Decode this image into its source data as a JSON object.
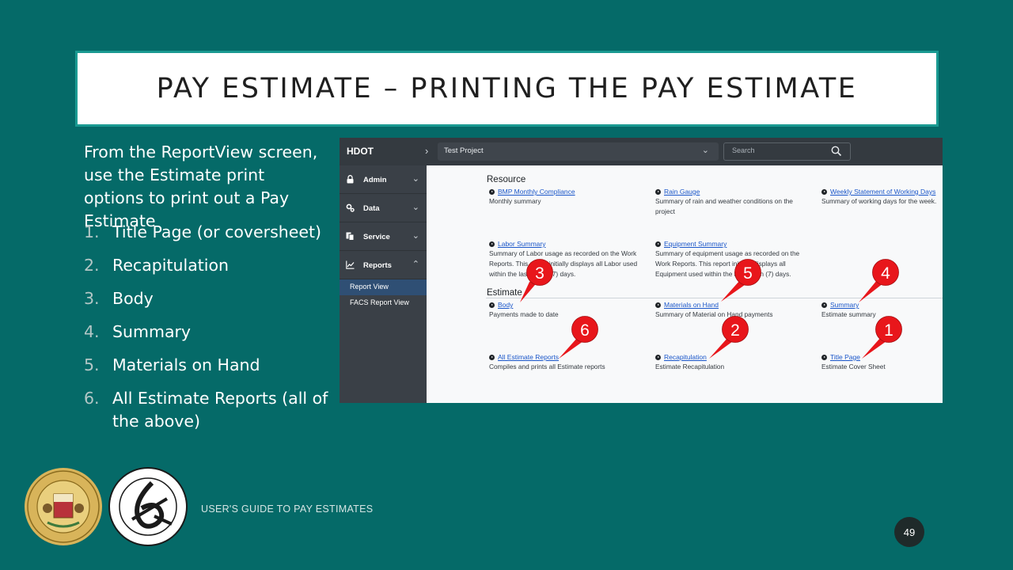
{
  "slide": {
    "title": "PAY ESTIMATE – PRINTING THE PAY ESTIMATE",
    "intro": "From the ReportView screen, use the Estimate print options to print out a Pay Estimate",
    "steps": [
      {
        "num": "1.",
        "text": "Title Page (or coversheet)"
      },
      {
        "num": "2.",
        "text": "Recapitulation"
      },
      {
        "num": "3.",
        "text": "Body"
      },
      {
        "num": "4.",
        "text": "Summary"
      },
      {
        "num": "5.",
        "text": "Materials on Hand"
      },
      {
        "num": "6.",
        "text": "All Estimate Reports (all of the above)"
      }
    ],
    "footer": "USER'S GUIDE TO PAY ESTIMATES",
    "page_number": "49",
    "background_color": "#056a68",
    "callout_color": "#e8161b"
  },
  "app": {
    "brand": "HDOT",
    "project": "Test Project",
    "search_placeholder": "Search",
    "nav": [
      {
        "label": "Admin",
        "icon": "lock-icon",
        "caret": "⌄"
      },
      {
        "label": "Data",
        "icon": "gears-icon",
        "caret": "⌄"
      },
      {
        "label": "Service",
        "icon": "copy-icon",
        "caret": "⌄"
      },
      {
        "label": "Reports",
        "icon": "chart-line-icon",
        "caret": "⌃"
      }
    ],
    "subnav": [
      "Report View",
      "FACS Report View"
    ],
    "sections": {
      "resource": "Resource",
      "estimate": "Estimate"
    },
    "resource_reports": [
      {
        "link": "BMP Monthly Compliance",
        "desc": "Monthly summary"
      },
      {
        "link": "Rain Gauge",
        "desc": "Summary of rain and weather conditions on the project"
      },
      {
        "link": "Weekly Statement of Working Days",
        "desc": "Summary of working days for the week."
      },
      {
        "link": "Labor Summary",
        "desc": "Summary of Labor usage as recorded on the Work Reports. This report initially displays all Labor used within the last seven (7) days."
      },
      {
        "link": "Equipment Summary",
        "desc": "Summary of equipment usage as recorded on the Work Reports. This report initially displays all Equipment used within the last seven (7) days."
      }
    ],
    "estimate_reports": [
      {
        "link": "Body",
        "desc": "Payments made to date"
      },
      {
        "link": "Materials on Hand",
        "desc": "Summary of Material on Hand payments"
      },
      {
        "link": "Summary",
        "desc": "Estimate summary"
      },
      {
        "link": "All Estimate Reports",
        "desc": "Compiles and prints all Estimate reports"
      },
      {
        "link": "Recapitulation",
        "desc": "Estimate Recapitulation"
      },
      {
        "link": "Title Page",
        "desc": "Estimate Cover Sheet"
      }
    ],
    "callouts": [
      "3",
      "5",
      "4",
      "6",
      "2",
      "1"
    ]
  }
}
